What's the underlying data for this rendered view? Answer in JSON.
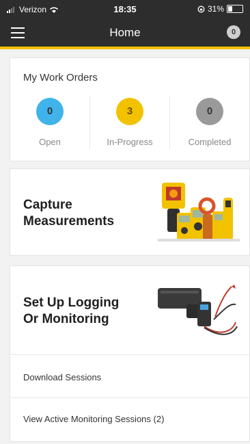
{
  "status_bar": {
    "carrier": "Verizon",
    "time": "18:35",
    "battery": "31%"
  },
  "header": {
    "title": "Home",
    "notification_count": "0"
  },
  "work_orders": {
    "heading": "My Work Orders",
    "items": [
      {
        "label": "Open",
        "count": "0",
        "color": "#3fb3ea"
      },
      {
        "label": "In-Progress",
        "count": "3",
        "color": "#f2c200"
      },
      {
        "label": "Completed",
        "count": "0",
        "color": "#9a9a9a"
      }
    ]
  },
  "capture": {
    "line1": "Capture",
    "line2": "Measurements"
  },
  "setup": {
    "line1": "Set Up Logging",
    "line2": "Or Monitoring",
    "download_label": "Download Sessions",
    "active_label": "View Active Monitoring Sessions (2)"
  },
  "colors": {
    "accent": "#f2c200",
    "header_bg": "#2d2d2d",
    "open": "#3fb3ea",
    "in_progress": "#f2c200",
    "completed": "#9a9a9a"
  }
}
